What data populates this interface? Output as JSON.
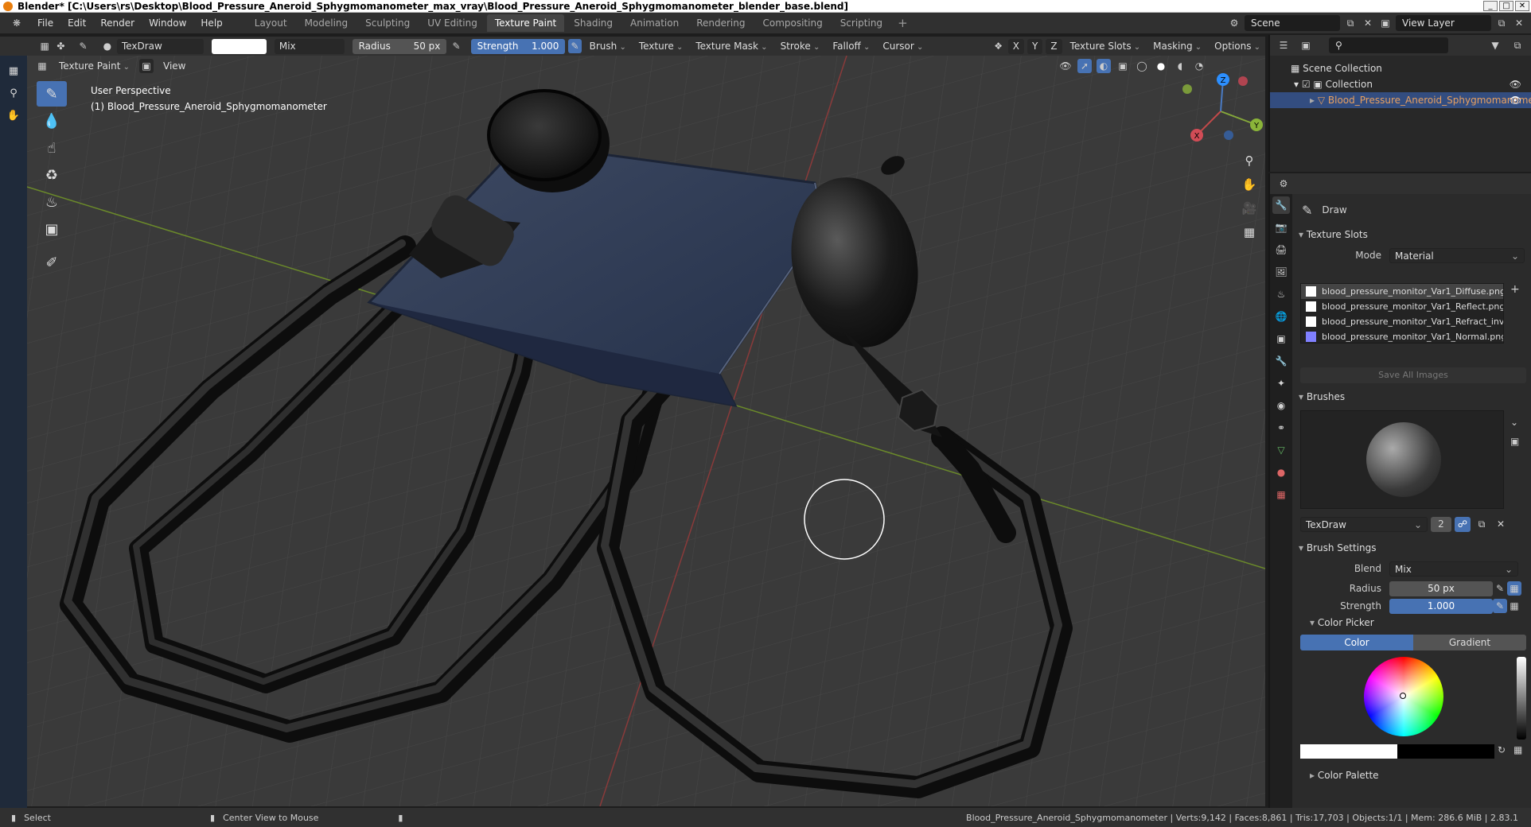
{
  "window": {
    "title": "Blender* [C:\\Users\\rs\\Desktop\\Blood_Pressure_Aneroid_Sphygmomanometer_max_vray\\Blood_Pressure_Aneroid_Sphygmomanometer_blender_base.blend]"
  },
  "menu": {
    "items": [
      "File",
      "Edit",
      "Render",
      "Window",
      "Help"
    ]
  },
  "workspaces": [
    "Layout",
    "Modeling",
    "Sculpting",
    "UV Editing",
    "Texture Paint",
    "Shading",
    "Animation",
    "Rendering",
    "Compositing",
    "Scripting"
  ],
  "topright": {
    "scene": "Scene",
    "view_layer": "View Layer"
  },
  "tool_header": {
    "brush_name": "TexDraw",
    "blend": "Mix",
    "radius_label": "Radius",
    "radius_value": "50 px",
    "strength_label": "Strength",
    "strength_value": "1.000",
    "brush": "Brush",
    "texture": "Texture",
    "texture_mask": "Texture Mask",
    "stroke": "Stroke",
    "falloff": "Falloff",
    "cursor": "Cursor",
    "x": "X",
    "y": "Y",
    "z": "Z",
    "texture_slots": "Texture Slots",
    "masking": "Masking",
    "options": "Options"
  },
  "sub_header": {
    "mode": "Texture Paint",
    "view": "View"
  },
  "viewport": {
    "perspective": "User Perspective",
    "object": "(1) Blood_Pressure_Aneroid_Sphygmomanometer",
    "gizmo": {
      "x": "X",
      "y": "Y",
      "z": "Z"
    },
    "colors": {
      "bg": "#3a3a3a",
      "grid": "#474747",
      "x_axis": "#8a3a3a",
      "y_axis": "#6b8a2a"
    }
  },
  "outliner": {
    "scene_collection": "Scene Collection",
    "collection": "Collection",
    "object": "Blood_Pressure_Aneroid_Sphygmomanometer"
  },
  "properties": {
    "tool_name": "Draw",
    "texture_slots": {
      "title": "Texture Slots",
      "mode_label": "Mode",
      "mode_value": "Material",
      "items": [
        {
          "name": "blood_pressure_monitor_Var1_Diffuse.png",
          "color": "#ffffff"
        },
        {
          "name": "blood_pressure_monitor_Var1_Reflect.png",
          "color": "#ffffff"
        },
        {
          "name": "blood_pressure_monitor_Var1_Refract_inv...",
          "color": "#ffffff"
        },
        {
          "name": "blood_pressure_monitor_Var1_Normal.png",
          "color": "#8080ff"
        }
      ],
      "save_all": "Save All Images"
    },
    "brushes": {
      "title": "Brushes",
      "name": "TexDraw",
      "users": "2"
    },
    "brush_settings": {
      "title": "Brush Settings",
      "blend_label": "Blend",
      "blend_value": "Mix",
      "radius_label": "Radius",
      "radius_value": "50 px",
      "strength_label": "Strength",
      "strength_value": "1.000"
    },
    "color_picker": {
      "title": "Color Picker",
      "tab_color": "Color",
      "tab_gradient": "Gradient"
    },
    "color_palette": {
      "title": "Color Palette"
    }
  },
  "statusbar": {
    "select": "Select",
    "center_view": "Center View to Mouse",
    "stats": "Blood_Pressure_Aneroid_Sphygmomanometer | Verts:9,142 | Faces:8,861 | Tris:17,703 | Objects:1/1 | Mem: 286.6 MiB | 2.83.1"
  }
}
